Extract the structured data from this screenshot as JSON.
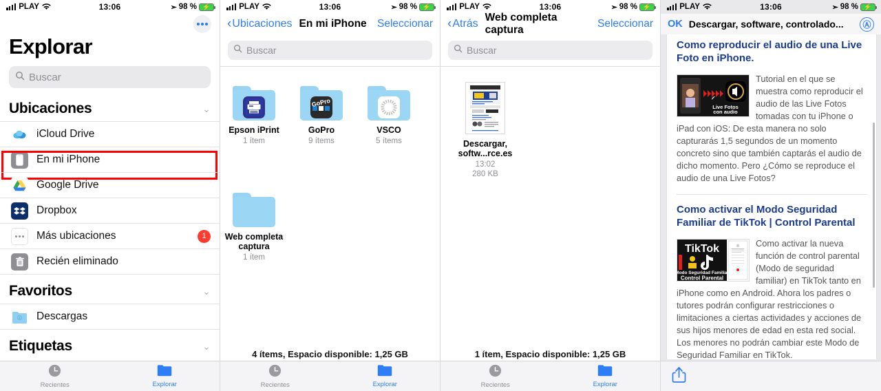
{
  "status_bar": {
    "carrier": "PLAY",
    "time": "13:06",
    "battery": "98 %",
    "wifi_icon": "wifi-icon",
    "signal_icon": "cellular-bars-icon",
    "location_icon": "location-arrow-icon",
    "battery_icon": "battery-charging-icon"
  },
  "panel1": {
    "more_button": "more-options-icon",
    "title": "Explorar",
    "search_placeholder": "Buscar",
    "sections": [
      {
        "heading": "Ubicaciones",
        "items": [
          {
            "label": "iCloud Drive",
            "icon": "icloud-icon",
            "badge": ""
          },
          {
            "label": "En mi iPhone",
            "icon": "iphone-icon",
            "badge": "",
            "highlighted": true
          },
          {
            "label": "Google Drive",
            "icon": "google-drive-icon",
            "badge": ""
          },
          {
            "label": "Dropbox",
            "icon": "dropbox-icon",
            "badge": ""
          },
          {
            "label": "Más ubicaciones",
            "icon": "ellipsis-icon",
            "badge": "1"
          },
          {
            "label": "Recién eliminado",
            "icon": "trash-icon",
            "badge": ""
          }
        ]
      },
      {
        "heading": "Favoritos",
        "items": [
          {
            "label": "Descargas",
            "icon": "downloads-folder-icon",
            "badge": ""
          }
        ]
      },
      {
        "heading": "Etiquetas",
        "items": []
      }
    ],
    "tabs": [
      {
        "label": "Recientes",
        "icon": "clock-icon",
        "active": false
      },
      {
        "label": "Explorar",
        "icon": "folder-icon",
        "active": true
      }
    ]
  },
  "panel2": {
    "back_label": "Ubicaciones",
    "title": "En mi iPhone",
    "action_label": "Seleccionar",
    "search_placeholder": "Buscar",
    "folders": [
      {
        "name": "Epson iPrint",
        "meta": "1 ítem",
        "icon": "epson-iprint-app-icon"
      },
      {
        "name": "GoPro",
        "meta": "9 ítems",
        "icon": "gopro-app-icon"
      },
      {
        "name": "VSCO",
        "meta": "5 ítems",
        "icon": "vsco-app-icon"
      },
      {
        "name": "Web completa captura",
        "meta": "1 ítem",
        "icon": "plain-folder-icon",
        "highlighted": true
      }
    ],
    "footer": "4 ítems, Espacio disponible: 1,25 GB",
    "tabs": [
      {
        "label": "Recientes",
        "icon": "clock-icon",
        "active": false
      },
      {
        "label": "Explorar",
        "icon": "folder-icon",
        "active": true
      }
    ]
  },
  "panel3": {
    "back_label": "Atrás",
    "title": "Web completa captura",
    "action_label": "Seleccionar",
    "search_placeholder": "Buscar",
    "files": [
      {
        "name": "Descargar, softw...rce.es",
        "time": "13:02",
        "size": "280 KB",
        "icon": "webarchive-thumbnail",
        "highlighted": true
      }
    ],
    "footer": "1 ítem, Espacio disponible: 1,25 GB",
    "tabs": [
      {
        "label": "Recientes",
        "icon": "clock-icon",
        "active": false
      },
      {
        "label": "Explorar",
        "icon": "folder-icon",
        "active": true
      }
    ]
  },
  "panel4": {
    "done_label": "OK",
    "page_title": "Descargar, software, controlado...",
    "reader_button": "aa-format-icon",
    "articles": [
      {
        "title": "Como reproducir el audio de una Live Foto en iPhone.",
        "thumb_caption": "Live Fotos con audio",
        "thumb_icon": "live-photo-thumbnail",
        "body": "Tutorial en el que se muestra como reproducir el audio de las Live Fotos tomadas con tu iPhone o iPad con iOS: De esta manera no solo capturarás 1,5 segundos de un momento concreto sino que también captarás el audio de dicho momento. Pero ¿Cómo se reproduce el audio de una Live Fotos?"
      },
      {
        "title": "Como activar el Modo Seguridad Familiar de TikTok | Control Parental",
        "thumb_caption": "TikTok Modo Seguridad Familiar Control Parental",
        "thumb_icon": "tiktok-thumbnail",
        "body": "Como activar la nueva función de control parental (Modo de seguridad familiar) en TikTok tanto en iPhone como en Android. Ahora los padres o tutores podrán configurar restricciones o limitaciones a ciertas actividades y acciones de sus hijos menores de edad en esta red social. Los menores no podrán cambiar este Modo de Seguridad Familiar en TikTok."
      }
    ],
    "share_button": "share-icon"
  },
  "colors": {
    "accent": "#2d7df6",
    "highlight": "#ff0000",
    "badge": "#ff3b30",
    "folder": "#9bd6f5"
  }
}
